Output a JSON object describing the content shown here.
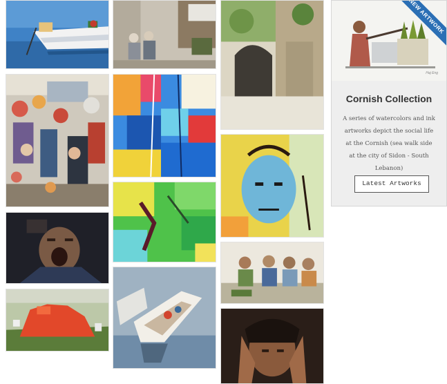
{
  "gallery": {
    "tiles": [
      {
        "name": "artwork-boat-harbor",
        "alt": "Painting of a boat on blue water"
      },
      {
        "name": "artwork-old-men-street",
        "alt": "Painting of old men sitting in a market street"
      },
      {
        "name": "artwork-alley-arch",
        "alt": "Watercolor of an arched alley"
      },
      {
        "name": "artwork-puppets-market",
        "alt": "Painting of puppets hanging in a market"
      },
      {
        "name": "artwork-abstract-boats",
        "alt": "Abstract colorful boats painting"
      },
      {
        "name": "artwork-yellow-face",
        "alt": "Expressive painting of a face on yellow"
      },
      {
        "name": "artwork-screaming-man",
        "alt": "Painting of a screaming man"
      },
      {
        "name": "artwork-green-abstract",
        "alt": "Green abstract painting"
      },
      {
        "name": "artwork-children-reading",
        "alt": "Watercolor of children reading"
      },
      {
        "name": "artwork-red-village",
        "alt": "Painting of a red village on a hill"
      },
      {
        "name": "artwork-fishing-boats",
        "alt": "Painting of fishing boats from above"
      },
      {
        "name": "artwork-head-in-hands",
        "alt": "Painting of a man holding his head"
      }
    ]
  },
  "featured": {
    "ribbon": "NEW ARTWORK",
    "signature": "Haj Eng",
    "title": "Cornish Collection",
    "description": "A series of watercolors and ink artworks depict the social life at the Cornish (sea walk side at the city of Sidon - South Lebanon)",
    "button_label": "Latest Artworks"
  }
}
